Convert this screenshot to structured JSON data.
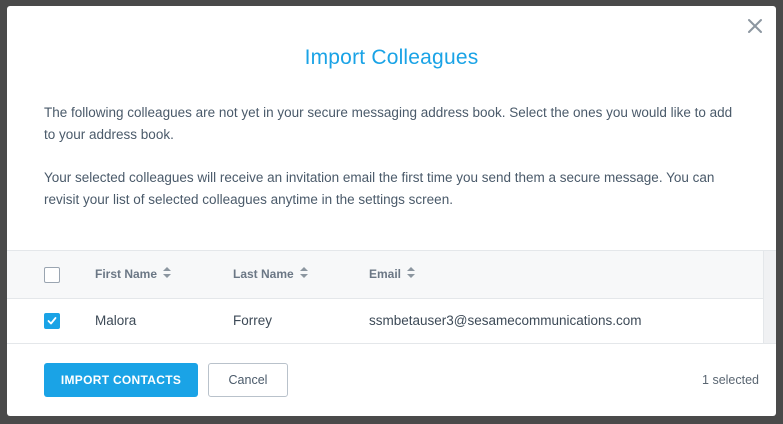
{
  "dialog": {
    "title": "Import Colleagues",
    "intro_text": "The following colleagues are not yet in your secure messaging address book. Select the ones you would like to add to your address book.",
    "invite_text": "Your selected colleagues will receive an invitation email the first time you send them a secure message. You can revisit your list of selected colleagues anytime in the settings screen."
  },
  "table": {
    "columns": [
      {
        "label": "First Name",
        "sortable": true
      },
      {
        "label": "Last Name",
        "sortable": true
      },
      {
        "label": "Email",
        "sortable": true
      }
    ],
    "select_all_checked": false,
    "rows": [
      {
        "checked": true,
        "first_name": "Malora",
        "last_name": "Forrey",
        "email": "ssmbetauser3@sesamecommunications.com"
      }
    ]
  },
  "footer": {
    "import_label": "IMPORT CONTACTS",
    "cancel_label": "Cancel",
    "selected_count": "1 selected"
  },
  "colors": {
    "accent": "#1aa3e6",
    "text": "#4a5a6a",
    "backdrop": "#4a4a4a"
  },
  "icons": {
    "close": "close-icon",
    "sort": "sort-icon",
    "check": "check-icon"
  }
}
